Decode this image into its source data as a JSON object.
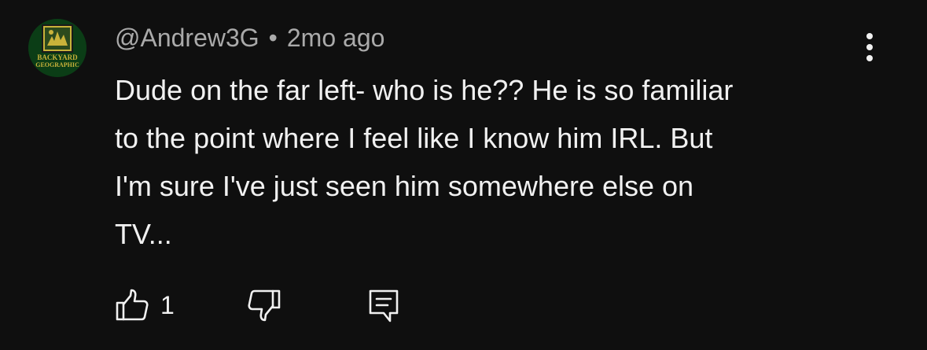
{
  "comment": {
    "avatar": {
      "icon": "channel-logo",
      "logo_text": [
        "BACKYARD",
        "GEOGRAPHIC"
      ],
      "background": "#0b3d16",
      "accent": "#c9b23a"
    },
    "author": "@Andrew3G",
    "separator": "•",
    "timestamp": "2mo ago",
    "text": "Dude on the far left- who is he?? He is so familiar\nto the point where I feel like I know him IRL. But\nI'm sure I've just seen him somewhere else on\nTV...",
    "actions": {
      "like_icon": "thumbs-up-icon",
      "like_count": "1",
      "dislike_icon": "thumbs-down-icon",
      "reply_icon": "reply-icon"
    },
    "menu_icon": "more-vert-icon"
  },
  "colors": {
    "background": "#0f0f0f",
    "primary_text": "#f1f1f1",
    "secondary_text": "#aaaaaa"
  }
}
